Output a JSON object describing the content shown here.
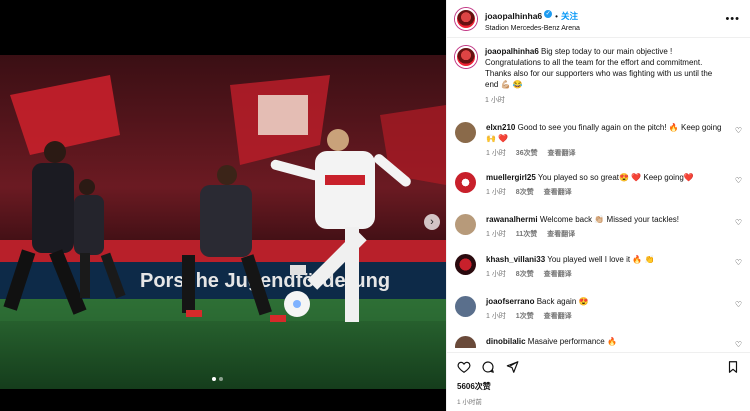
{
  "header": {
    "username": "joaopalhinha6",
    "follow_label": "关注",
    "location": "Stadion Mercedes-Benz Arena",
    "separator": "•",
    "more_icon": "more-horizontal-icon"
  },
  "caption": {
    "username": "joaopalhinha6",
    "text": "Big step today to our main objective ! Congratulations to all the team for the effort and commitment. Thanks also for our supporters who was fighting with us until the end 💪🏼 😂",
    "time": "1 小时"
  },
  "comments": [
    {
      "username": "elxn210",
      "text": "Good to see you finally again on the pitch! 🔥 Keep going 🙌 ❤️",
      "time": "1 小时",
      "likes": "36次赞",
      "translate": "查看翻译"
    },
    {
      "username": "muellergirl25",
      "text": "You played so so great😍 ❤️ Keep going❤️",
      "time": "1 小时",
      "likes": "8次赞",
      "translate": "查看翻译"
    },
    {
      "username": "rawanalhermi",
      "text": "Welcome back 👏🏼 Missed your tackles!",
      "time": "1 小时",
      "likes": "11次赞",
      "translate": "查看翻译"
    },
    {
      "username": "khash_villani33",
      "text": "You played well I love it 🔥 👏",
      "time": "1 小时",
      "likes": "8次赞",
      "translate": "查看翻译"
    },
    {
      "username": "joaofserrano",
      "text": "Back again 😍",
      "time": "1 小时",
      "likes": "1次赞",
      "translate": "查看翻译"
    },
    {
      "username": "dinobilalic",
      "text": "Masaive performance 🔥",
      "time": "",
      "likes": "",
      "translate": ""
    }
  ],
  "actions": {
    "like_icon": "heart-icon",
    "comment_icon": "comment-icon",
    "share_icon": "send-icon",
    "save_icon": "bookmark-icon"
  },
  "post": {
    "likes": "5606次赞",
    "time": "1 小时前"
  },
  "carousel": {
    "next_icon": "chevron-right-icon",
    "slide_count": 2,
    "active_index": 0
  },
  "colors": {
    "accent": "#0095f6",
    "verified": "#1d9bf0",
    "pitch": "#1f5a2a",
    "banner": "#c8202b"
  }
}
